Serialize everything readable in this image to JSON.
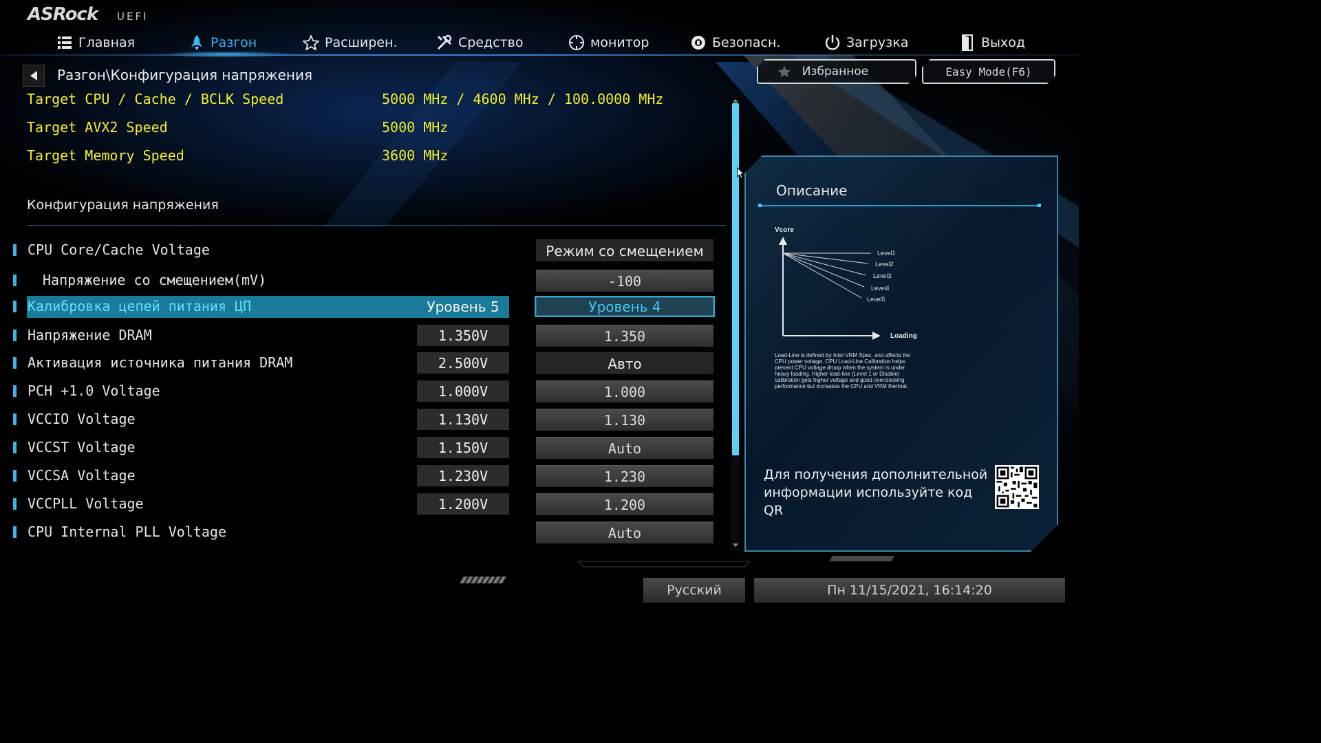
{
  "brand": {
    "logo": "ASRock",
    "sub": "UEFI"
  },
  "nav": {
    "items": [
      {
        "label": "Главная",
        "icon": "list-icon"
      },
      {
        "label": "Разгон",
        "icon": "rocket-icon",
        "active": true
      },
      {
        "label": "Расширен.",
        "icon": "star-icon"
      },
      {
        "label": "Средство",
        "icon": "tools-icon"
      },
      {
        "label": "монитор",
        "icon": "monitor-icon"
      },
      {
        "label": "Безопасн.",
        "icon": "shield-icon"
      },
      {
        "label": "Загрузка",
        "icon": "power-icon"
      },
      {
        "label": "Выход",
        "icon": "exit-icon"
      }
    ],
    "active_color": "#39b8ef"
  },
  "breadcrumb": "Разгон\\Конфигурация напряжения",
  "favorites_label": "Избранное",
  "easy_mode_label": "Easy Mode(F6)",
  "targets": [
    {
      "label": "Target CPU / Cache / BCLK Speed",
      "value": "5000 MHz / 4600 MHz / 100.0000 MHz"
    },
    {
      "label": "Target AVX2 Speed",
      "value": "5000 MHz"
    },
    {
      "label": "Target Memory Speed",
      "value": "3600 MHz"
    }
  ],
  "target_color": "#f4ee2a",
  "section_title": "Конфигурация напряжения",
  "settings": [
    {
      "label": "CPU Core/Cache Voltage",
      "current": "",
      "control": "Режим со смещением",
      "dark": true
    },
    {
      "label": "Напряжение со смещением(mV)",
      "current": "",
      "control": "-100",
      "indent": true
    },
    {
      "label": "Калибровка цепей питания ЦП",
      "current": "Уровень 5",
      "control": "Уровень 4",
      "selected": true
    },
    {
      "label": "Напряжение DRAM",
      "current": "1.350V",
      "control": "1.350"
    },
    {
      "label": "Активация источника питания DRAM",
      "current": "2.500V",
      "control": "Авто",
      "dark": true
    },
    {
      "label": "PCH +1.0 Voltage",
      "current": "1.000V",
      "control": "1.000"
    },
    {
      "label": "VCCIO Voltage",
      "current": "1.130V",
      "control": "1.130"
    },
    {
      "label": "VCCST Voltage",
      "current": "1.150V",
      "control": "Auto"
    },
    {
      "label": "VCCSA Voltage",
      "current": "1.230V",
      "control": "1.230"
    },
    {
      "label": "VCCPLL Voltage",
      "current": "1.200V",
      "control": "1.200"
    },
    {
      "label": "CPU Internal PLL Voltage",
      "current": "",
      "control": "Auto"
    }
  ],
  "description": {
    "title": "Описание",
    "diagram": {
      "y_label": "Vcore",
      "x_label": "Loading",
      "levels": [
        "Level1",
        "Level2",
        "Level3",
        "Level4",
        "Level5"
      ]
    },
    "text": "Load-Line is defined by Intel VRM Spec. and affects the CPU power voltage. CPU Load-Line Calibration helps prevent CPU voltage droop when the system is under heavy loading. Higher load-line (Level 1 or Disable) calibration gets higher voltage and good overclocking performance but increases the CPU and VRM thermal.",
    "qr_text": "Для получения дополнительной информации используйте код QR"
  },
  "language": "Русский",
  "datetime": "Пн 11/15/2021, 16:14:20"
}
